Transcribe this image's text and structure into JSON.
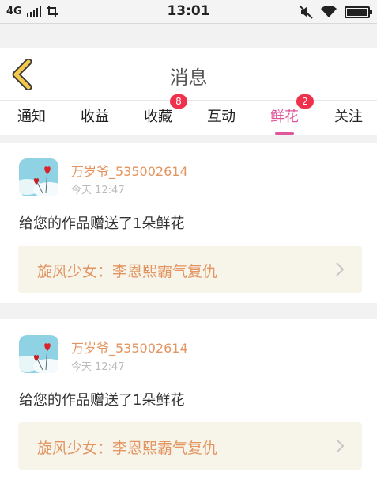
{
  "status_bar": {
    "network": "4G",
    "time": "13:01",
    "battery_level_percent": 95
  },
  "header": {
    "title": "消息",
    "back_icon": "chevron-left-icon"
  },
  "tabs": [
    {
      "label": "通知",
      "badge": "",
      "active": false
    },
    {
      "label": "收益",
      "badge": "",
      "active": false
    },
    {
      "label": "收藏",
      "badge": "8",
      "active": false
    },
    {
      "label": "互动",
      "badge": "",
      "active": false
    },
    {
      "label": "鲜花",
      "badge": "2",
      "active": true
    },
    {
      "label": "关注",
      "badge": "",
      "active": false
    }
  ],
  "messages": [
    {
      "user": "万岁爷_535002614",
      "time": "今天 12:47",
      "text": "给您的作品赠送了1朵鲜花",
      "work_title": "旋风少女：李恩熙霸气复仇"
    },
    {
      "user": "万岁爷_535002614",
      "time": "今天 12:47",
      "text": "给您的作品赠送了1朵鲜花",
      "work_title": "旋风少女：李恩熙霸气复仇"
    }
  ],
  "colors": {
    "accent_pink": "#e0569a",
    "badge_red": "#f0314b",
    "username_orange": "#e39561",
    "back_arrow_yellow": "#f2c94c"
  }
}
